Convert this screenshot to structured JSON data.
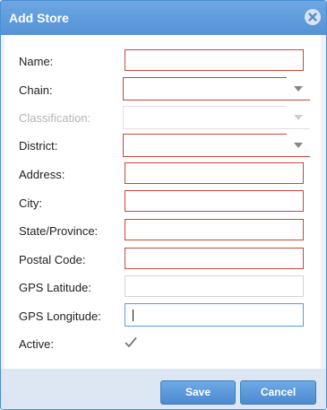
{
  "dialog": {
    "title": "Add Store",
    "close_icon": "close-circle-icon"
  },
  "form": {
    "name": {
      "label": "Name:",
      "value": ""
    },
    "chain": {
      "label": "Chain:",
      "value": ""
    },
    "classification": {
      "label": "Classification:",
      "value": "",
      "disabled": true
    },
    "district": {
      "label": "District:",
      "value": ""
    },
    "address": {
      "label": "Address:",
      "value": ""
    },
    "city": {
      "label": "City:",
      "value": ""
    },
    "state_province": {
      "label": "State/Province:",
      "value": ""
    },
    "postal_code": {
      "label": "Postal Code:",
      "value": ""
    },
    "gps_latitude": {
      "label": "GPS Latitude:",
      "value": ""
    },
    "gps_longitude": {
      "label": "GPS Longitude:",
      "value": ""
    },
    "active": {
      "label": "Active:",
      "checked": true
    }
  },
  "footer": {
    "save_label": "Save",
    "cancel_label": "Cancel"
  },
  "colors": {
    "titlebar": "#5e9bdc",
    "required_border": "#c9473b",
    "focus_border": "#5d9bd8",
    "button": "#5a95d8"
  }
}
